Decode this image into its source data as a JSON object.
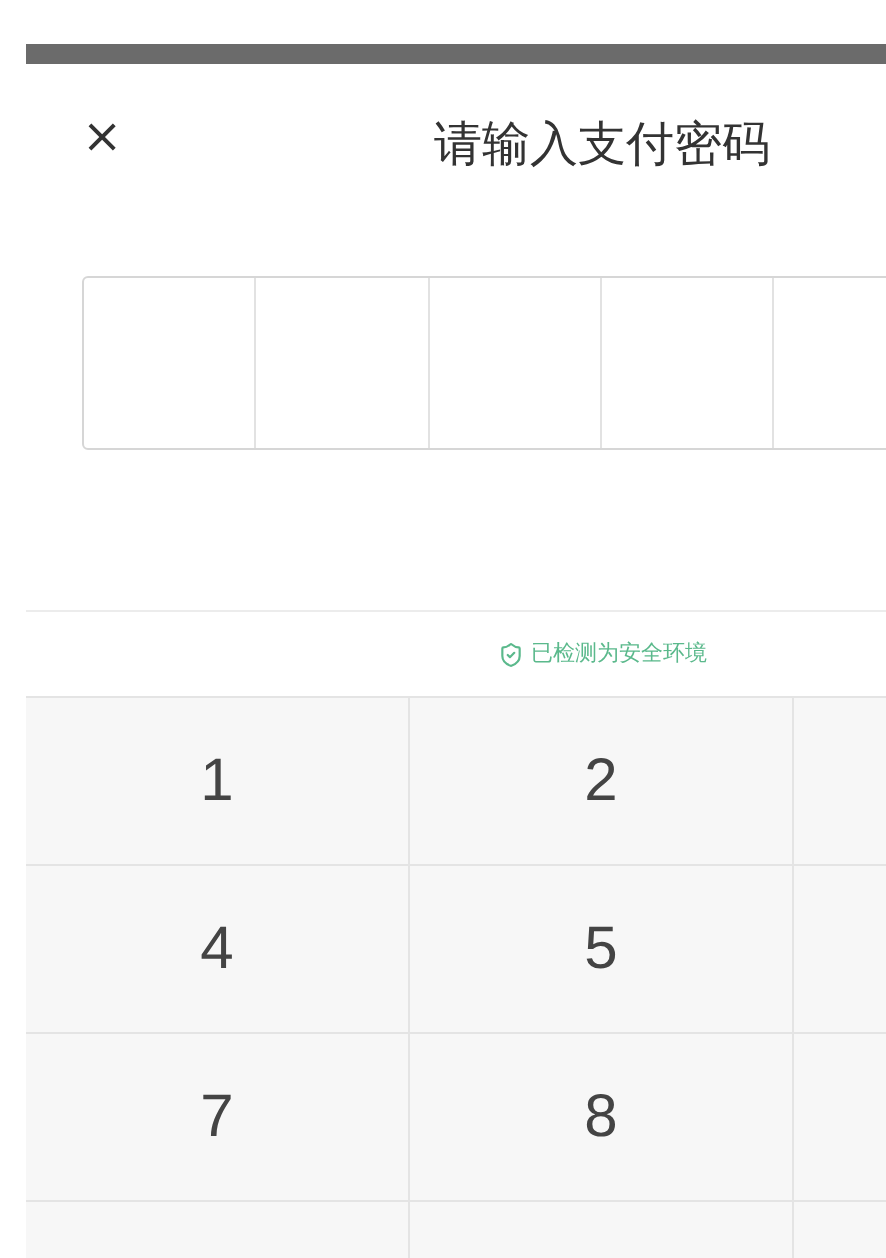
{
  "dialog": {
    "close": "×",
    "title": "请输入支付密码"
  },
  "security_notice": {
    "text": "已检测为安全环境",
    "color": "#5bb98c"
  },
  "keypad": {
    "rows": [
      [
        "1",
        "2"
      ],
      [
        "4",
        "5"
      ],
      [
        "7",
        "8"
      ],
      []
    ]
  }
}
